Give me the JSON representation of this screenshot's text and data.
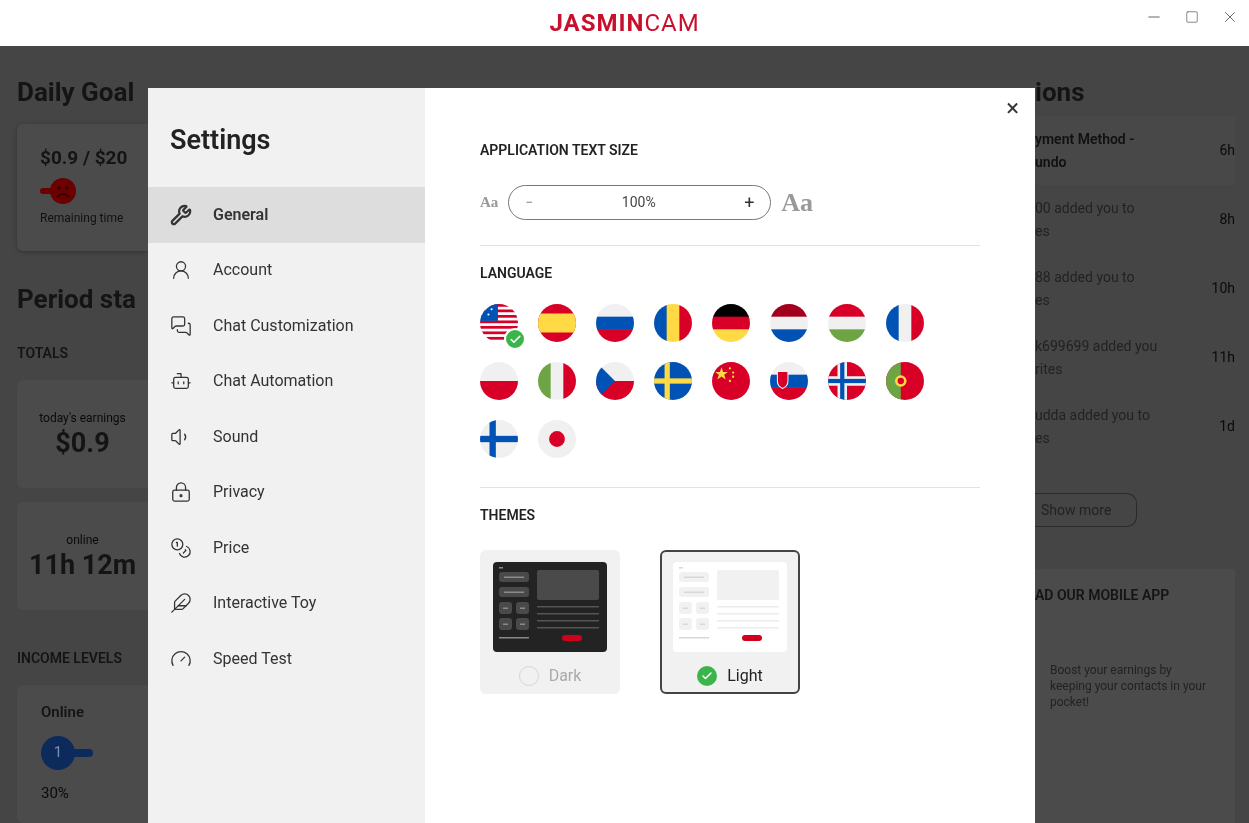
{
  "titlebar": {
    "logo": "**JASMIN**CAM"
  },
  "left_panel": {
    "daily_goal_title": "Daily Goal",
    "goal_amount": "$0.9 / $20",
    "remaining_label": "Remaining time",
    "period_title": "Period sta",
    "totals_label": "TOTALS",
    "totals": [
      {
        "caption": "today's earnings",
        "value": "$0.9"
      },
      {
        "caption": "online",
        "value": "11h 12m"
      }
    ],
    "income_label": "INCOME LEVELS",
    "income_card": {
      "title": "Online",
      "step": "1",
      "percent": "30%"
    }
  },
  "settings": {
    "title": "Settings",
    "close": "×",
    "nav": [
      {
        "label": "General",
        "selected": true
      },
      {
        "label": "Account",
        "selected": false
      },
      {
        "label": "Chat Customization",
        "selected": false
      },
      {
        "label": "Chat Automation",
        "selected": false
      },
      {
        "label": "Sound",
        "selected": false
      },
      {
        "label": "Privacy",
        "selected": false
      },
      {
        "label": "Price",
        "selected": false
      },
      {
        "label": "Interactive Toy",
        "selected": false
      },
      {
        "label": "Speed Test",
        "selected": false
      }
    ],
    "text_size": {
      "heading": "APPLICATION TEXT SIZE",
      "small_label": "Aa",
      "decrease": "−",
      "value": "100%",
      "increase": "+",
      "large_label": "Aa"
    },
    "language": {
      "heading": "LANGUAGE",
      "options": [
        {
          "selected": true
        },
        {
          "selected": false
        },
        {
          "selected": false
        },
        {
          "selected": false
        },
        {
          "selected": false
        },
        {
          "selected": false
        },
        {
          "selected": false
        },
        {
          "selected": false
        },
        {
          "selected": false
        },
        {
          "selected": false
        },
        {
          "selected": false
        },
        {
          "selected": false
        },
        {
          "selected": false
        },
        {
          "selected": false
        },
        {
          "selected": false
        },
        {
          "selected": false
        },
        {
          "selected": false
        },
        {
          "selected": false
        }
      ]
    },
    "themes": {
      "heading": "THEMES",
      "options": [
        {
          "kind": "dark",
          "label": "Dark",
          "selected": false
        },
        {
          "kind": "light",
          "label": "Light",
          "selected": true
        }
      ]
    }
  },
  "notifications": {
    "heading": "ions",
    "items": [
      {
        "lines": [
          "yment Method -",
          "undo"
        ],
        "time": "6h",
        "unread": true
      },
      {
        "lines": [
          "00 added you to",
          "es"
        ],
        "time": "8h",
        "unread": false
      },
      {
        "lines": [
          "88 added you to",
          "es"
        ],
        "time": "10h",
        "unread": false
      },
      {
        "lines": [
          "k699699 added you",
          "rites"
        ],
        "time": "11h",
        "unread": false
      },
      {
        "lines": [
          "udda added you to",
          "es"
        ],
        "time": "1d",
        "unread": false
      }
    ],
    "show_more": "Show more",
    "app_card": {
      "title": "AD OUR MOBILE APP",
      "text": "Boost your earnings by keeping your contacts in your pocket!"
    }
  }
}
